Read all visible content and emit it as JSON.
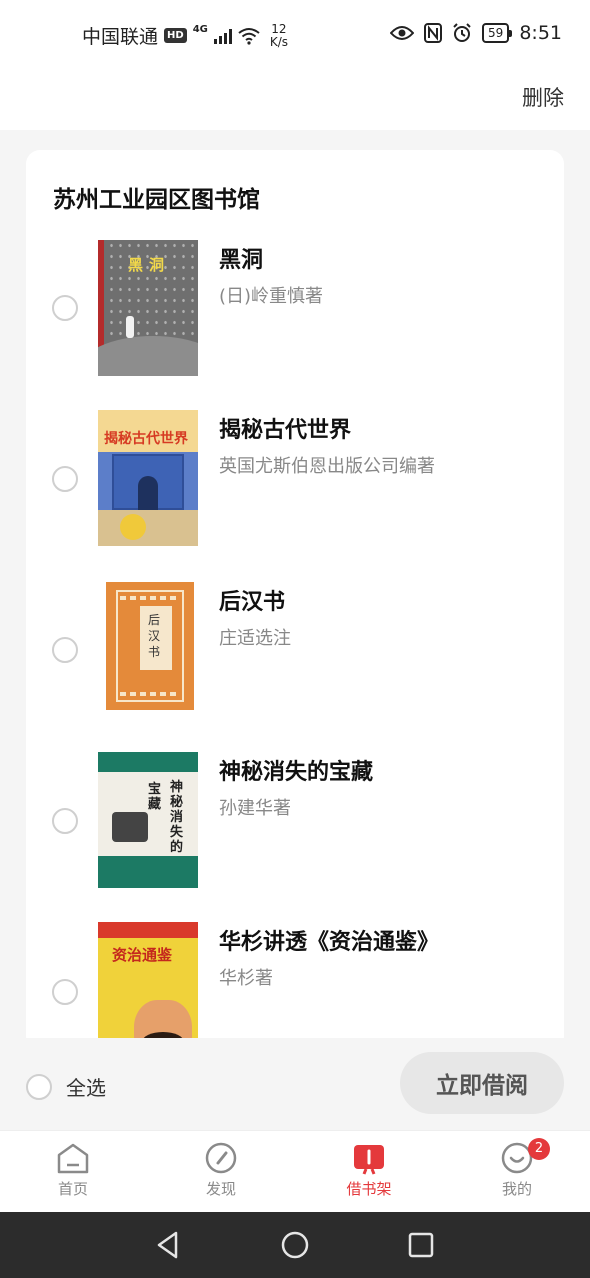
{
  "status_bar": {
    "carrier": "中国联通",
    "hd": "HD",
    "network": "4G",
    "speed_value": "12",
    "speed_unit": "K/s",
    "battery": "59",
    "time": "8:51"
  },
  "header": {
    "delete_label": "删除"
  },
  "library": {
    "name": "苏州工业园区图书馆"
  },
  "books": [
    {
      "title": "黑洞",
      "author": "(日)岭重慎著",
      "cover_text": "黑洞"
    },
    {
      "title": "揭秘古代世界",
      "author": "英国尤斯伯恩出版公司编著",
      "cover_text": "揭秘古代世界"
    },
    {
      "title": "后汉书",
      "author": "庄适选注",
      "cover_text": "后汉书"
    },
    {
      "title": "神秘消失的宝藏",
      "author": "孙建华著",
      "cover_text_a": "神秘消失的",
      "cover_text_b": "宝藏"
    },
    {
      "title": "华杉讲透《资治通鉴》",
      "author": "华杉著",
      "cover_text": "资治通鉴"
    }
  ],
  "footer": {
    "select_all_label": "全选",
    "borrow_label": "立即借阅"
  },
  "tabs": [
    {
      "label": "首页",
      "icon": "home-icon"
    },
    {
      "label": "发现",
      "icon": "compass-icon"
    },
    {
      "label": "借书架",
      "icon": "bookshelf-icon"
    },
    {
      "label": "我的",
      "icon": "profile-icon",
      "badge": "2"
    }
  ],
  "colors": {
    "accent": "#e4393c",
    "button_bg": "#e7e7e7"
  }
}
